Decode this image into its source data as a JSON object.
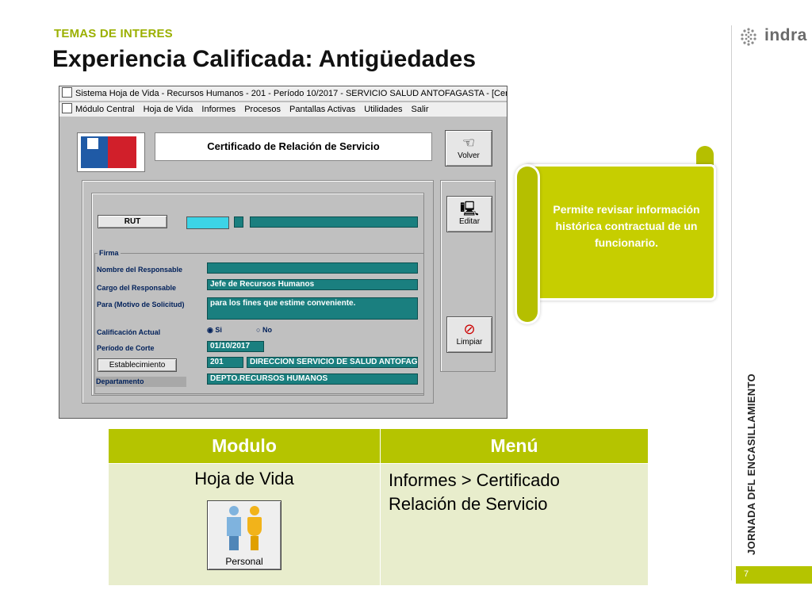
{
  "slide": {
    "eyebrow": "TEMAS DE INTERES",
    "title": "Experiencia Calificada: Antigüedades",
    "vertical_label": "JORNADA DFL ENCASILLAMIENTO",
    "page_number": "7",
    "brand": "indra",
    "accent_color": "#b5c400"
  },
  "app": {
    "window_title": "Sistema Hoja de Vida - Recursos Humanos - 201 - Período 10/2017 - SERVICIO SALUD ANTOFAGASTA - [Certificado de Rel",
    "menu": [
      "Módulo Central",
      "Hoja de Vida",
      "Informes",
      "Procesos",
      "Pantallas Activas",
      "Utilidades",
      "Salir"
    ],
    "form_title": "Certificado de Relación de Servicio",
    "buttons": {
      "volver": "Volver",
      "editar": "Editar",
      "limpiar": "Limpiar",
      "rut": "RUT",
      "establecimiento": "Establecimiento"
    },
    "firma": {
      "group_label": "Firma",
      "nombre_label": "Nombre del Responsable",
      "cargo_label": "Cargo del Responsable",
      "cargo_value": "Jefe de Recursos Humanos",
      "para_label": "Para (Motivo de Solicitud)",
      "para_value": "para los fines que estime conveniente.",
      "calificacion_label": "Calificación Actual",
      "option_si": "Si",
      "option_no": "No",
      "calificacion_selected": "Si",
      "periodo_label": "Período de Corte",
      "periodo_value": "01/10/2017",
      "establecimiento_code": "201",
      "establecimiento_name": "DIRECCION SERVICIO DE SALUD ANTOFAGASTA",
      "departamento_label": "Departamento",
      "departamento_value": "DEPTO.RECURSOS HUMANOS"
    }
  },
  "callout": {
    "text": "Permite revisar información histórica contractual de un funcionario."
  },
  "table": {
    "headers": [
      "Modulo",
      "Menú"
    ],
    "row": {
      "modulo": "Hoja de Vida",
      "menu_line1": "Informes > Certificado",
      "menu_line2": "Relación de Servicio",
      "icon_caption": "Personal"
    }
  }
}
